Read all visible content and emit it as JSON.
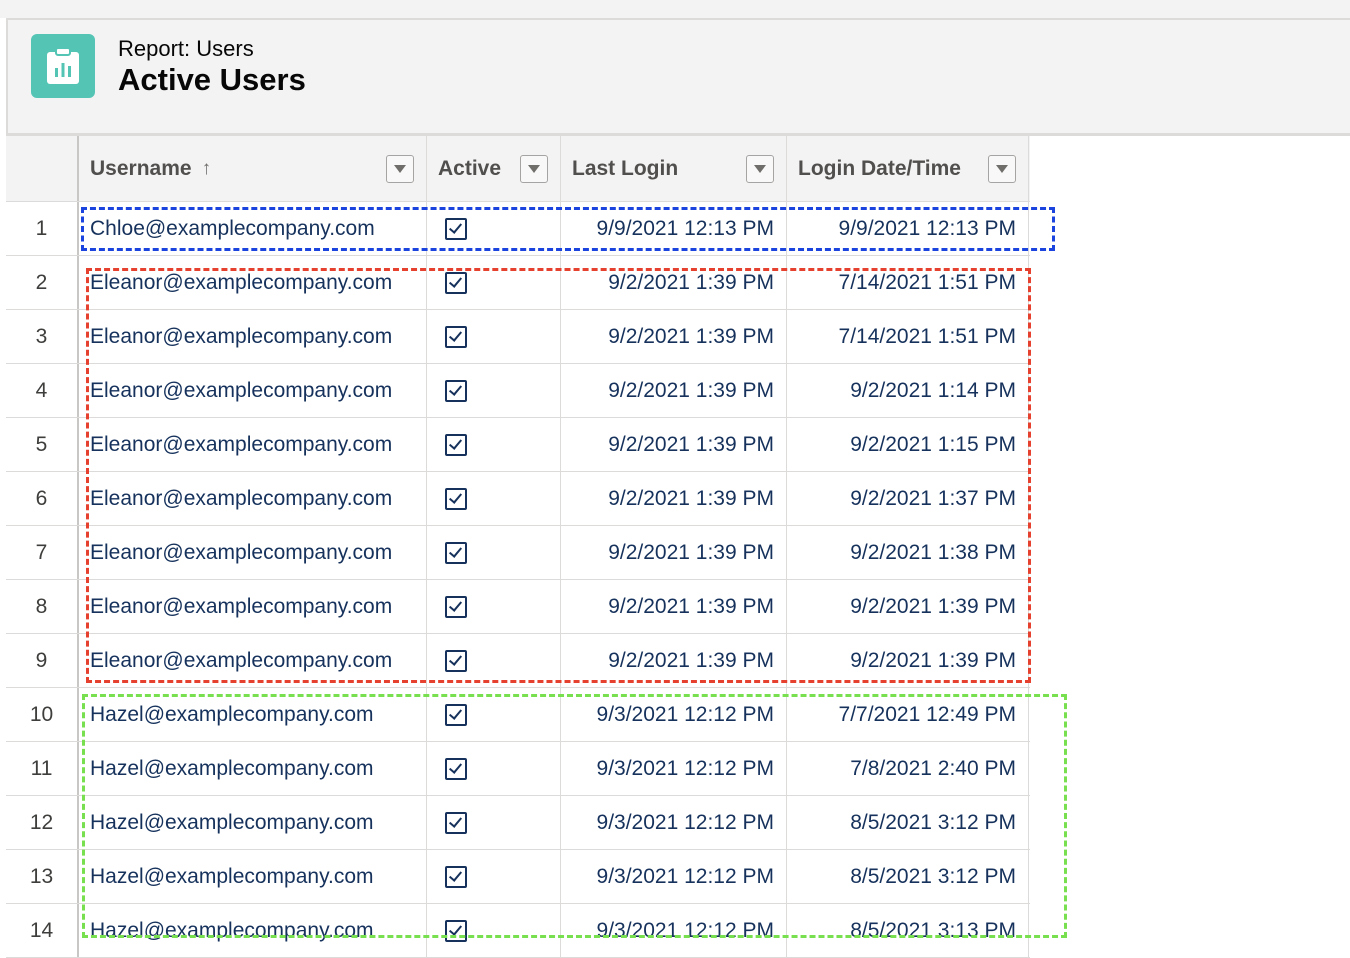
{
  "header": {
    "report_type": "Report: Users",
    "title": "Active Users",
    "icon": "report-icon"
  },
  "table": {
    "columns": {
      "username": "Username",
      "active": "Active",
      "last_login": "Last Login",
      "login_datetime": "Login Date/Time"
    },
    "sort": {
      "column": "Username",
      "direction": "ascending"
    },
    "rows": [
      {
        "n": "1",
        "user": "Chloe@examplecompany.com",
        "active": true,
        "last": "9/9/2021 12:13 PM",
        "login": "9/9/2021 12:13 PM"
      },
      {
        "n": "2",
        "user": "Eleanor@examplecompany.com",
        "active": true,
        "last": "9/2/2021 1:39 PM",
        "login": "7/14/2021 1:51 PM"
      },
      {
        "n": "3",
        "user": "Eleanor@examplecompany.com",
        "active": true,
        "last": "9/2/2021 1:39 PM",
        "login": "7/14/2021 1:51 PM"
      },
      {
        "n": "4",
        "user": "Eleanor@examplecompany.com",
        "active": true,
        "last": "9/2/2021 1:39 PM",
        "login": "9/2/2021 1:14 PM"
      },
      {
        "n": "5",
        "user": "Eleanor@examplecompany.com",
        "active": true,
        "last": "9/2/2021 1:39 PM",
        "login": "9/2/2021 1:15 PM"
      },
      {
        "n": "6",
        "user": "Eleanor@examplecompany.com",
        "active": true,
        "last": "9/2/2021 1:39 PM",
        "login": "9/2/2021 1:37 PM"
      },
      {
        "n": "7",
        "user": "Eleanor@examplecompany.com",
        "active": true,
        "last": "9/2/2021 1:39 PM",
        "login": "9/2/2021 1:38 PM"
      },
      {
        "n": "8",
        "user": "Eleanor@examplecompany.com",
        "active": true,
        "last": "9/2/2021 1:39 PM",
        "login": "9/2/2021 1:39 PM"
      },
      {
        "n": "9",
        "user": "Eleanor@examplecompany.com",
        "active": true,
        "last": "9/2/2021 1:39 PM",
        "login": "9/2/2021 1:39 PM"
      },
      {
        "n": "10",
        "user": "Hazel@examplecompany.com",
        "active": true,
        "last": "9/3/2021 12:12 PM",
        "login": "7/7/2021 12:49 PM"
      },
      {
        "n": "11",
        "user": "Hazel@examplecompany.com",
        "active": true,
        "last": "9/3/2021 12:12 PM",
        "login": "7/8/2021 2:40 PM"
      },
      {
        "n": "12",
        "user": "Hazel@examplecompany.com",
        "active": true,
        "last": "9/3/2021 12:12 PM",
        "login": "8/5/2021 3:12 PM"
      },
      {
        "n": "13",
        "user": "Hazel@examplecompany.com",
        "active": true,
        "last": "9/3/2021 12:12 PM",
        "login": "8/5/2021 3:12 PM"
      },
      {
        "n": "14",
        "user": "Hazel@examplecompany.com",
        "active": true,
        "last": "9/3/2021 12:12 PM",
        "login": "8/5/2021 3:13 PM"
      }
    ]
  },
  "highlights": {
    "colors": {
      "chloe": "#1b43de",
      "eleanor": "#e5412e",
      "hazel": "#78e04e"
    }
  },
  "colors": {
    "icon_bg": "#54c4b5",
    "text": "#16325c",
    "header_bg": "#f3f3f3"
  }
}
